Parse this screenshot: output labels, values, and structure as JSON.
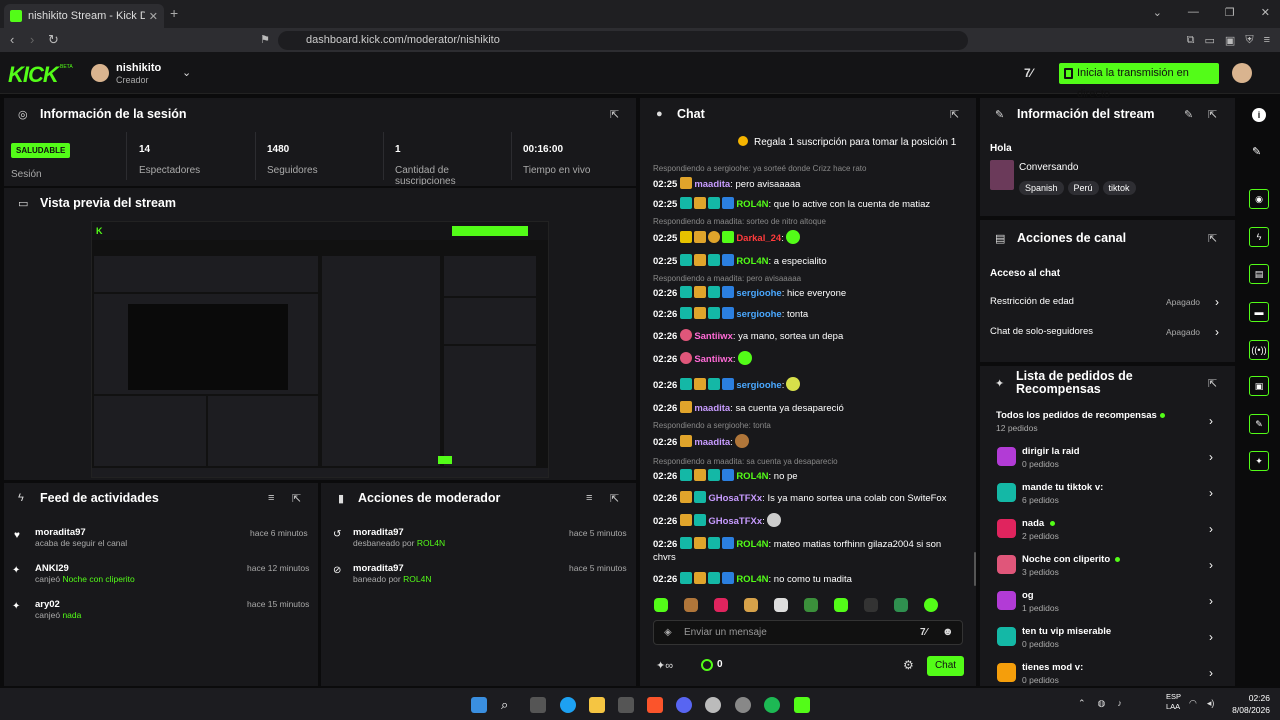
{
  "browser": {
    "tab_title": "nishikito Stream - Kick Dashb",
    "url": "dashboard.kick.com/moderator/nishikito"
  },
  "header": {
    "logo": "KICK",
    "beta": "BETA",
    "username": "nishikito",
    "role": "Creador",
    "start_button": "Inicia la transmisión en directo"
  },
  "session": {
    "title": "Información de la sesión",
    "badge": "SALUDABLE",
    "badge_label": "Sesión",
    "stats": [
      {
        "value": "14",
        "label": "Espectadores"
      },
      {
        "value": "1480",
        "label": "Seguidores"
      },
      {
        "value": "1",
        "label": "Cantidad de suscripciones"
      },
      {
        "value": "00:16:00",
        "label": "Tiempo en vivo"
      }
    ]
  },
  "preview": {
    "title": "Vista previa del stream"
  },
  "feed": {
    "title": "Feed de actividades",
    "items": [
      {
        "user": "moradita97",
        "desc": "acaba de seguir el canal",
        "highlight": "",
        "time": "hace 6 minutos"
      },
      {
        "user": "ANKI29",
        "desc": "canjeó",
        "highlight": "Noche con cliperito",
        "time": "hace 12 minutos"
      },
      {
        "user": "ary02",
        "desc": "canjeó",
        "highlight": "nada",
        "time": "hace 15 minutos"
      }
    ]
  },
  "modactions": {
    "title": "Acciones de moderador",
    "items": [
      {
        "user": "moradita97",
        "desc": "desbaneado por",
        "by": "ROL4N",
        "time": "hace 5 minutos"
      },
      {
        "user": "moradita97",
        "desc": "baneado por",
        "by": "ROL4N",
        "time": "hace 5 minutos"
      }
    ]
  },
  "chat": {
    "title": "Chat",
    "pinned": "Regala 1 suscripción para tomar la posición 1",
    "replies": [
      "Respondiendo a sergioohe: ya sorteé donde Crizz hace rato",
      "Respondiendo a maadita: sorteo de nitro altoque",
      "Respondiendo a maadita: pero avisaaaaa",
      "Respondiendo a sergioohe: tonta",
      "Respondiendo a maadita: sa cuenta ya desaparecio"
    ],
    "messages": [
      {
        "time": "02:25",
        "user": "maadita",
        "color": "#c79bff",
        "text": ": pero avisaaaaa"
      },
      {
        "time": "02:25",
        "user": "ROL4N",
        "color": "#53fc18",
        "text": ": que lo active con la cuenta de matiaz"
      },
      {
        "time": "02:25",
        "user": "Darkal_24",
        "color": "#ff3b3b",
        "text": ":"
      },
      {
        "time": "02:25",
        "user": "ROL4N",
        "color": "#53fc18",
        "text": ": a especialito"
      },
      {
        "time": "02:26",
        "user": "sergioohe",
        "color": "#4aa8ff",
        "text": ": hice everyone"
      },
      {
        "time": "02:26",
        "user": "sergioohe",
        "color": "#4aa8ff",
        "text": ": tonta"
      },
      {
        "time": "02:26",
        "user": "Santiiwx",
        "color": "#ff6bd6",
        "text": ": ya mano, sortea un depa"
      },
      {
        "time": "02:26",
        "user": "Santiiwx",
        "color": "#ff6bd6",
        "text": ":"
      },
      {
        "time": "02:26",
        "user": "sergioohe",
        "color": "#4aa8ff",
        "text": ":"
      },
      {
        "time": "02:26",
        "user": "maadita",
        "color": "#c79bff",
        "text": ": sa cuenta ya desapareció"
      },
      {
        "time": "02:26",
        "user": "maadita",
        "color": "#c79bff",
        "text": ":"
      },
      {
        "time": "02:26",
        "user": "ROL4N",
        "color": "#53fc18",
        "text": ": no pe"
      },
      {
        "time": "02:26",
        "user": "GHosaTFXx",
        "color": "#c79bff",
        "text": ": Is ya mano sortea una colab con SwiteFox"
      },
      {
        "time": "02:26",
        "user": "GHosaTFXx",
        "color": "#c79bff",
        "text": ":"
      },
      {
        "time": "02:26",
        "user": "ROL4N",
        "color": "#53fc18",
        "text": ": mateo matias torfhinn gilaza2004 si son"
      },
      {
        "time": "",
        "user": "",
        "color": "#fff",
        "text": "chvrs"
      },
      {
        "time": "02:26",
        "user": "ROL4N",
        "color": "#53fc18",
        "text": ": no como tu madita"
      }
    ],
    "input_placeholder": "Enviar un mensaje",
    "count": "0",
    "send_button": "Chat"
  },
  "stream_info": {
    "title": "Información del stream",
    "stream_title": "Hola",
    "category": "Conversando",
    "tags": [
      "Spanish",
      "Perú",
      "tiktok"
    ]
  },
  "channel_actions": {
    "title": "Acciones de canal",
    "section": "Acceso al chat",
    "rows": [
      {
        "label": "Restricción de edad",
        "value": "Apagado"
      },
      {
        "label": "Chat de solo-seguidores",
        "value": "Apagado"
      }
    ]
  },
  "rewards": {
    "title": "Lista de pedidos de Recompensas",
    "all_label": "Todos los pedidos de recompensas",
    "all_count": "12 pedidos",
    "items": [
      {
        "name": "dirigir la raid",
        "count": "0 pedidos",
        "color": "#b23bd6",
        "dot": false
      },
      {
        "name": "mande tu tiktok v:",
        "count": "6 pedidos",
        "color": "#14b8a6",
        "dot": false
      },
      {
        "name": "nada",
        "count": "2 pedidos",
        "color": "#e0245e",
        "dot": true
      },
      {
        "name": "Noche con cliperito",
        "count": "3 pedidos",
        "color": "#e0567a",
        "dot": true
      },
      {
        "name": "og",
        "count": "1 pedidos",
        "color": "#b23bd6",
        "dot": false
      },
      {
        "name": "ten tu vip miserable",
        "count": "0 pedidos",
        "color": "#14b8a6",
        "dot": false
      },
      {
        "name": "tienes mod v:",
        "count": "0 pedidos",
        "color": "#f59e0b",
        "dot": false
      }
    ]
  },
  "taskbar": {
    "lang": "ESP",
    "lang2": "LAA",
    "time": "02:26",
    "date": "8/08/2026"
  }
}
